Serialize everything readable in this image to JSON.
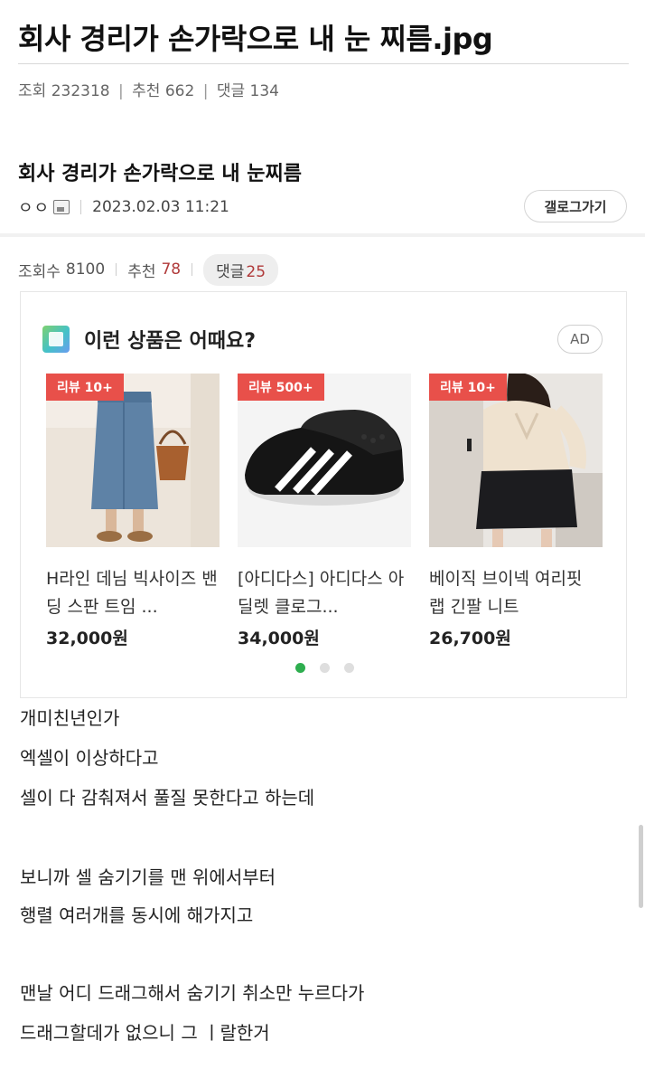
{
  "page_title": "회사 경리가 손가락으로 내 눈 찌름.jpg",
  "meta": {
    "views_label": "조회",
    "views": "232318",
    "likes_label": "추천",
    "likes": "662",
    "comments_label": "댓글",
    "comments": "134"
  },
  "post": {
    "title": "회사 경리가 손가락으로 내 눈찌름",
    "author": "ㅇㅇ",
    "datetime": "2023.02.03 11:21",
    "gallery_button": "갤로그가기",
    "stats": {
      "views_label": "조회수",
      "views": "8100",
      "likes_label": "추천",
      "likes": "78",
      "comments_label": "댓글",
      "comments": "25"
    }
  },
  "ad": {
    "heading": "이런 상품은 어때요?",
    "badge": "AD",
    "products": [
      {
        "badge": "리뷰 10+",
        "name": "H라인 데님 빅사이즈 밴딩 스판 트임 ...",
        "price": "32,000원"
      },
      {
        "badge": "리뷰 500+",
        "name": "[아디다스] 아디다스 아딜렛 클로그...",
        "price": "34,000원"
      },
      {
        "badge": "리뷰 10+",
        "name": "베이직 브이넥 여리핏 랩 긴팔 니트",
        "price": "26,700원"
      }
    ],
    "page_count": 3,
    "active_page": 1
  },
  "body_lines": [
    "개미친년인가",
    "엑셀이 이상하다고",
    "셀이 다 감춰져서 풀질 못한다고 하는데",
    "",
    "보니까 셀 숨기기를 맨 위에서부터",
    "행렬 여러개를 동시에 해가지고",
    "",
    "맨날 어디 드래그해서 숨기기 취소만 누르다가",
    "드래그할데가 없으니 그 ㅣ랄한거"
  ],
  "colors": {
    "accent_red": "#b03a3a",
    "badge_red": "#e8504a",
    "dot_active": "#2eae4f"
  }
}
